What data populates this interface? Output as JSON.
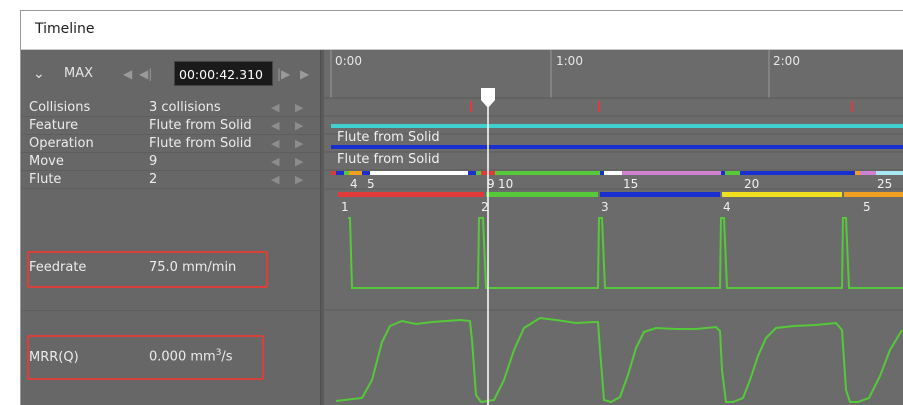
{
  "window": {
    "title": "Timeline"
  },
  "controls": {
    "collapse_glyph": "⌄",
    "zoom_label": "MAX",
    "time": "00:00:42.310",
    "nav_prev_glyph": "◀",
    "nav_prev_step_glyph": "◀|",
    "nav_next_step_glyph": "|▶",
    "nav_next_glyph": "▶"
  },
  "tracks": [
    {
      "label": "Collisions",
      "value": "3 collisions"
    },
    {
      "label": "Feature",
      "value": "Flute from Solid"
    },
    {
      "label": "Operation",
      "value": "Flute from Solid"
    },
    {
      "label": "Move",
      "value": "9"
    },
    {
      "label": "Flute",
      "value": "2"
    }
  ],
  "charts": {
    "feedrate": {
      "label": "Feedrate",
      "value": "75.0 mm/min"
    },
    "mrr": {
      "label": "MRR(Q)",
      "value_main": "0.000 mm",
      "value_sup": "3",
      "value_tail": "/s"
    }
  },
  "ruler": {
    "ticks": [
      "0:00",
      "1:00",
      "2:00"
    ]
  },
  "bar_labels": {
    "feature": "Flute from Solid",
    "operation": "Flute from Solid"
  },
  "move_numbers": [
    "4",
    "5",
    "9",
    "10",
    "15",
    "20",
    "25"
  ],
  "flute_numbers": [
    "1",
    "2",
    "3",
    "4",
    "5"
  ],
  "colors": {
    "feature_bar": "#40d0cf",
    "operation_bar": "#1a2fd0",
    "collision_mark": "#e03a3a",
    "plot_line": "#55c93a",
    "highlight_box": "#d9403a",
    "playhead": "#ffffff"
  }
}
